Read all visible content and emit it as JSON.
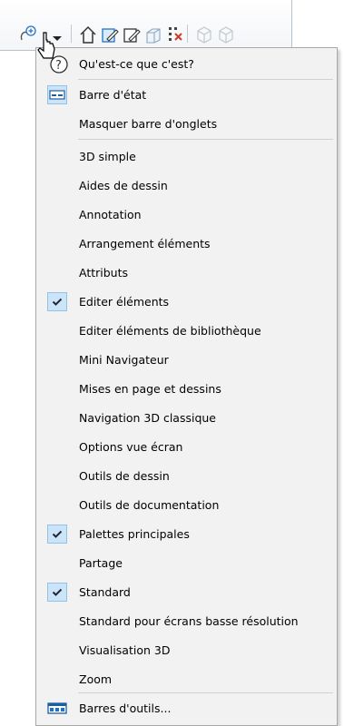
{
  "toolbar": {
    "buttons": [
      "help-zoom-icon",
      "dropdown-arrow-icon",
      "house-icon",
      "edit-element-icon",
      "edit-element-2-icon",
      "box-icon",
      "grid-x-icon",
      "cube-1-icon",
      "cube-2-icon"
    ]
  },
  "menu": {
    "whats_this": "Qu'est-ce que c'est?",
    "items": [
      {
        "label": "Barre d'état",
        "checked": false,
        "icon": "statusbar-icon"
      },
      {
        "label": "Masquer barre d'onglets",
        "checked": false
      },
      {
        "label": "3D simple",
        "checked": false
      },
      {
        "label": "Aides de dessin",
        "checked": false
      },
      {
        "label": "Annotation",
        "checked": false
      },
      {
        "label": "Arrangement éléments",
        "checked": false
      },
      {
        "label": "Attributs",
        "checked": false
      },
      {
        "label": "Editer éléments",
        "checked": true
      },
      {
        "label": "Editer éléments de bibliothèque",
        "checked": false
      },
      {
        "label": "Mini Navigateur",
        "checked": false
      },
      {
        "label": "Mises en page et dessins",
        "checked": false
      },
      {
        "label": "Navigation 3D classique",
        "checked": false
      },
      {
        "label": "Options vue écran",
        "checked": false
      },
      {
        "label": "Outils de dessin",
        "checked": false
      },
      {
        "label": "Outils de documentation",
        "checked": false
      },
      {
        "label": "Palettes principales",
        "checked": true
      },
      {
        "label": "Partage",
        "checked": false
      },
      {
        "label": "Standard",
        "checked": true
      },
      {
        "label": "Standard pour écrans basse résolution",
        "checked": false
      },
      {
        "label": "Visualisation 3D",
        "checked": false
      },
      {
        "label": "Zoom",
        "checked": false
      },
      {
        "label": "Barres d'outils...",
        "checked": false,
        "icon": "toolbars-icon"
      }
    ]
  },
  "colors": {
    "check_bg": "#cce4f7",
    "check_border": "#93c1e8",
    "menu_bg": "#f2f2f2",
    "accent": "#1e73c8"
  }
}
